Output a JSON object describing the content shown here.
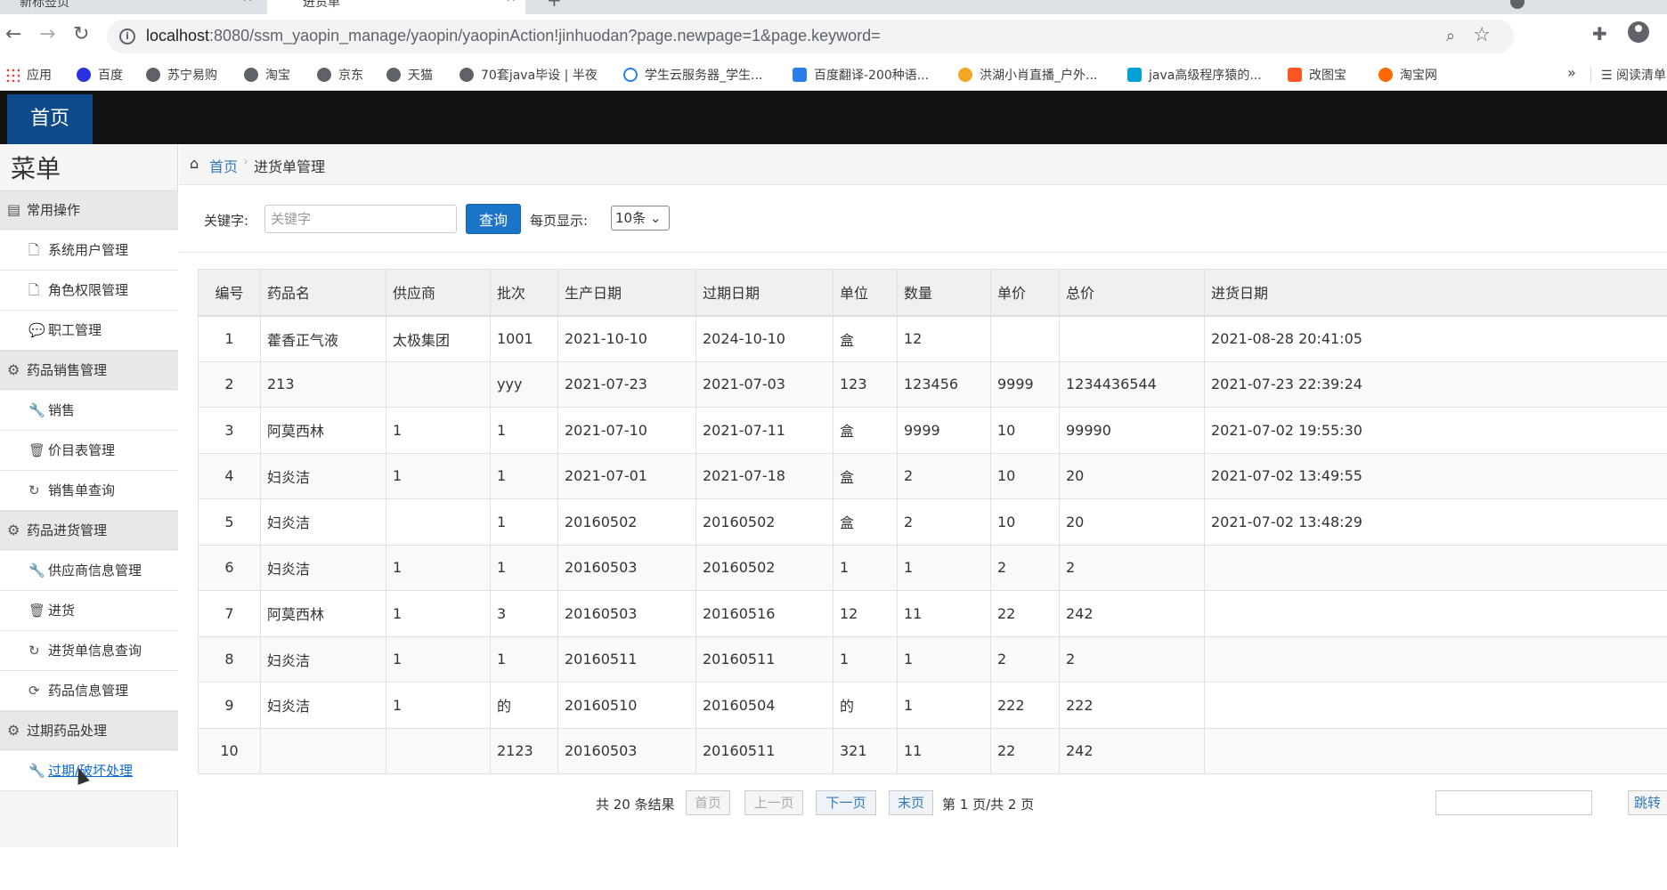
{
  "browser": {
    "tabs": [
      {
        "title": "新标签页"
      },
      {
        "title": "进货单"
      }
    ],
    "url_host": "localhost",
    "url_path": ":8080/ssm_yaopin_manage/yaopin/yaopinAction!jinhuodan?page.newpage=1&page.keyword=",
    "bookmarks": [
      {
        "label": "应用",
        "icon": "apps-icon"
      },
      {
        "label": "百度",
        "icon": "baidu-icon"
      },
      {
        "label": "苏宁易购",
        "icon": "globe-icon"
      },
      {
        "label": "淘宝",
        "icon": "globe-icon"
      },
      {
        "label": "京东",
        "icon": "globe-icon"
      },
      {
        "label": "天猫",
        "icon": "globe-icon"
      },
      {
        "label": "70套java毕设 | 半夜",
        "icon": "globe-icon"
      },
      {
        "label": "学生云服务器_学生...",
        "icon": "cloud-icon"
      },
      {
        "label": "百度翻译-200种语...",
        "icon": "translate-icon"
      },
      {
        "label": "洪湖小肖直播_户外...",
        "icon": "gif-icon"
      },
      {
        "label": "java高级程序猿的...",
        "icon": "tv-icon"
      },
      {
        "label": "改图宝",
        "icon": "cut-icon"
      },
      {
        "label": "淘宝网",
        "icon": "taobao-icon"
      }
    ],
    "more": "»",
    "reading_list": "阅读清单"
  },
  "app": {
    "home_tab": "首页",
    "menu_title": "菜单",
    "sidebar": {
      "groups": [
        {
          "label": "常用操作",
          "items": [
            {
              "label": "系统用户管理",
              "icon": "file-icon"
            },
            {
              "label": "角色权限管理",
              "icon": "file-icon"
            },
            {
              "label": "职工管理",
              "icon": "comment-icon"
            }
          ]
        },
        {
          "label": "药品销售管理",
          "items": [
            {
              "label": "销售",
              "icon": "wrench-icon"
            },
            {
              "label": "价目表管理",
              "icon": "trash-icon"
            },
            {
              "label": "销售单查询",
              "icon": "refresh-icon"
            }
          ]
        },
        {
          "label": "药品进货管理",
          "items": [
            {
              "label": "供应商信息管理",
              "icon": "wrench-icon"
            },
            {
              "label": "进货",
              "icon": "trash-icon"
            },
            {
              "label": "进货单信息查询",
              "icon": "refresh-icon"
            },
            {
              "label": "药品信息管理",
              "icon": "sync-icon"
            }
          ]
        },
        {
          "label": "过期药品处理",
          "items": [
            {
              "label": "过期/破坏处理",
              "icon": "wrench-icon"
            }
          ]
        }
      ]
    },
    "breadcrumb": {
      "home": "首页",
      "current": "进货单管理"
    },
    "search": {
      "keyword_label": "关键字:",
      "keyword_placeholder": "关键字",
      "keyword_value": "",
      "search_button": "查询",
      "perpage_label": "每页显示:",
      "perpage_value": "10条"
    },
    "table": {
      "columns": [
        "编号",
        "药品名",
        "供应商",
        "批次",
        "生产日期",
        "过期日期",
        "单位",
        "数量",
        "单价",
        "总价",
        "进货日期"
      ],
      "rows": [
        [
          "1",
          "藿香正气液",
          "太极集团",
          "1001",
          "2021-10-10",
          "2024-10-10",
          "盒",
          "12",
          "",
          "",
          "2021-08-28 20:41:05"
        ],
        [
          "2",
          "213",
          "",
          "yyy",
          "2021-07-23",
          "2021-07-03",
          "123",
          "123456",
          "9999",
          "1234436544",
          "2021-07-23 22:39:24"
        ],
        [
          "3",
          "阿莫西林",
          "1",
          "1",
          "2021-07-10",
          "2021-07-11",
          "盒",
          "9999",
          "10",
          "99990",
          "2021-07-02 19:55:30"
        ],
        [
          "4",
          "妇炎洁",
          "1",
          "1",
          "2021-07-01",
          "2021-07-18",
          "盒",
          "2",
          "10",
          "20",
          "2021-07-02 13:49:55"
        ],
        [
          "5",
          "妇炎洁",
          "",
          "1",
          "20160502",
          "20160502",
          "盒",
          "2",
          "10",
          "20",
          "2021-07-02 13:48:29"
        ],
        [
          "6",
          "妇炎洁",
          "1",
          "1",
          "20160503",
          "20160502",
          "1",
          "1",
          "2",
          "2",
          ""
        ],
        [
          "7",
          "阿莫西林",
          "1",
          "3",
          "20160503",
          "20160516",
          "12",
          "11",
          "22",
          "242",
          ""
        ],
        [
          "8",
          "妇炎洁",
          "1",
          "1",
          "20160511",
          "20160511",
          "1",
          "1",
          "2",
          "2",
          ""
        ],
        [
          "9",
          "妇炎洁",
          "1",
          "的",
          "20160510",
          "20160504",
          "的",
          "1",
          "222",
          "222",
          ""
        ],
        [
          "10",
          "",
          "",
          "2123",
          "20160503",
          "20160511",
          "321",
          "11",
          "22",
          "242",
          ""
        ]
      ]
    },
    "pager": {
      "total": "共 20 条结果",
      "first": "首页",
      "prev": "上一页",
      "next": "下一页",
      "last": "末页",
      "page_info": "第 1 页/共 2 页",
      "jump": "跳转"
    }
  }
}
